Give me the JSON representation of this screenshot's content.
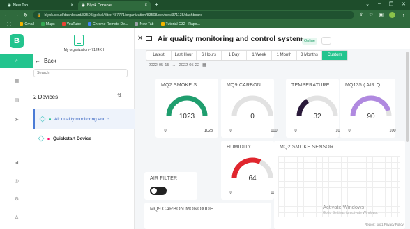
{
  "browser": {
    "tabs": [
      {
        "label": "New Tab"
      },
      {
        "label": "Blynk.Console"
      }
    ],
    "url": "blynk.cloud/dashboard/83508/global/filter/487771/organization/83508/devices/371135/dashboard",
    "bookmarks": [
      "Gmail",
      "Maps",
      "YouTube",
      "Chrome Remote De...",
      "New Tab",
      "Tutorial C32 - Rapo..."
    ]
  },
  "sidebar": {
    "brand": "B",
    "org_name": "My organization - 7124XH",
    "back_label": "Back",
    "search_placeholder": "Search",
    "device_count": "2 Devices",
    "devices": [
      {
        "name": "Air quality monitoring and c..."
      },
      {
        "name": "Quickstart Device"
      }
    ]
  },
  "dashboard": {
    "title": "Air quality monitoring and control system",
    "status": "Online",
    "more": "···",
    "ranges": [
      "Latest",
      "Last Hour",
      "6 Hours",
      "1 Day",
      "1 Week",
      "1 Month",
      "3 Months",
      "Custom"
    ],
    "selected_range": "Custom",
    "date_from": "2022-05-15",
    "date_sep": "→",
    "date_to": "2022-05-22",
    "gauges": [
      {
        "title": "MQ2 SMOKE S...",
        "value": "1023",
        "min": "0",
        "max": "1023",
        "fraction": 1.0,
        "color": "#1f9e6e"
      },
      {
        "title": "MQ9 CARBON ...",
        "value": "0",
        "min": "0",
        "max": "100",
        "fraction": 0.0,
        "color": "#cccccc"
      },
      {
        "title": "TEMPERATURE ...",
        "value": "32",
        "min": "0",
        "max": "100",
        "fraction": 0.32,
        "color": "#2b1b3b"
      },
      {
        "title": "MQ135 ( AIR Q...",
        "value": "90",
        "min": "0",
        "max": "100",
        "fraction": 0.9,
        "color": "#b089e0"
      },
      {
        "title": "HUMIDITY",
        "value": "64",
        "min": "0",
        "max": "100",
        "fraction": 0.64,
        "color": "#e0262e"
      }
    ],
    "air_filter": {
      "title": "AIR FILTER",
      "on": false
    },
    "chart_title": "MQ2 SMOKE SENSOR",
    "mq9_title": "MQ9 CARBON MONOXIDE",
    "watermark": "Activate Windows",
    "watermark_sub": "Go to Settings to activate Windows.",
    "region": "Region: sgp1   Privacy Policy"
  }
}
